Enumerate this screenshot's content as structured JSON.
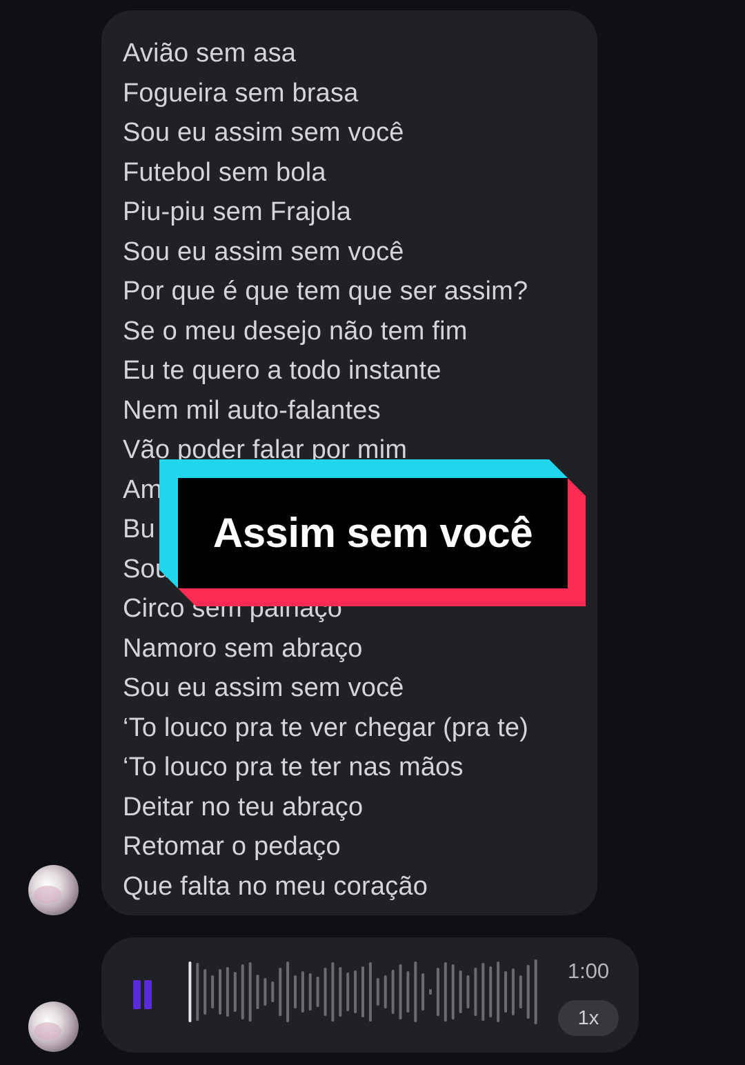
{
  "lyrics_message": {
    "lines": [
      "Avião sem asa",
      "Fogueira sem brasa",
      "Sou eu assim sem você",
      "Futebol sem bola",
      "Piu-piu sem Frajola",
      "Sou eu assim sem você",
      "Por que é que tem que ser assim?",
      "Se o meu desejo não tem fim",
      "Eu te quero a todo instante",
      "Nem mil auto-falantes",
      "Vão poder falar por mim",
      "Am",
      "Bu",
      "Sou",
      "Circo sem palhaço",
      "Namoro sem abraço",
      "Sou eu assim sem você",
      "‘To louco pra te ver chegar (pra te)",
      "‘To louco pra te ter nas mãos",
      "Deitar no teu abraço",
      "Retomar o pedaço",
      "Que falta no meu coração"
    ]
  },
  "title_overlay": {
    "text": "Assim sem você",
    "colors": {
      "cyan": "#20d5ec",
      "pink": "#fe2c55",
      "box": "#000000",
      "text": "#ffffff"
    }
  },
  "audio_message": {
    "state_icon": "pause-icon",
    "duration": "1:00",
    "speed": "1x",
    "played_fraction": 0.03,
    "accent_color": "#5a2bd9"
  }
}
